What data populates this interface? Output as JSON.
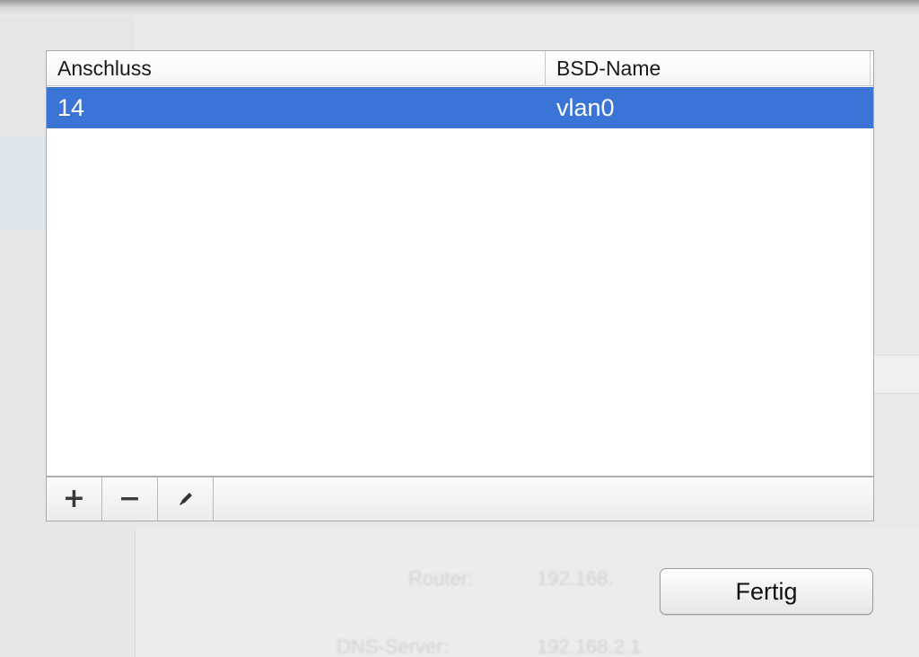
{
  "table": {
    "columns": [
      "Anschluss",
      "BSD-Name"
    ],
    "rows": [
      {
        "port": "14",
        "bsd_name": "vlan0",
        "selected": true
      }
    ]
  },
  "toolbar": {
    "add_glyph": "+",
    "remove_glyph": "−",
    "edit_icon": "pencil-icon"
  },
  "done_button": {
    "label": "Fertig"
  },
  "background": {
    "router_label": "Router:",
    "router_value": "192.168.",
    "dns_label": "DNS-Server:",
    "dns_value": "192.168.2.1"
  },
  "colors": {
    "selection": "#3a74d6",
    "selection_text": "#ffffff"
  }
}
